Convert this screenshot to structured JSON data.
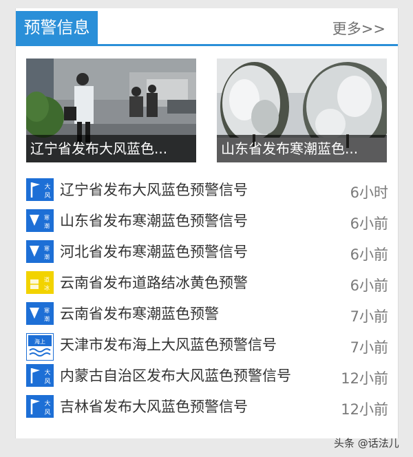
{
  "header": {
    "title": "预警信息",
    "more": "更多>>"
  },
  "featured": [
    {
      "caption": "辽宁省发布大风蓝色...",
      "image": "person-in-windy-street"
    },
    {
      "caption": "山东省发布寒潮蓝色...",
      "image": "snow-covered-trees"
    }
  ],
  "news": [
    {
      "icon": "gale-blue-signal-icon",
      "title": "辽宁省发布大风蓝色预警信号",
      "time": "6小时"
    },
    {
      "icon": "cold-wave-blue-signal-icon",
      "title": "山东省发布寒潮蓝色预警信号",
      "time": "6小前"
    },
    {
      "icon": "cold-wave-blue-signal-icon",
      "title": "河北省发布寒潮蓝色预警信号",
      "time": "6小前"
    },
    {
      "icon": "road-icing-yellow-signal-icon",
      "title": "云南省发布道路结冰黄色预警",
      "time": "6小前"
    },
    {
      "icon": "cold-wave-blue-signal-icon",
      "title": "云南省发布寒潮蓝色预警",
      "time": "7小前"
    },
    {
      "icon": "sea-gale-blue-signal-icon",
      "title": "天津市发布海上大风蓝色预警信号",
      "time": "7小前"
    },
    {
      "icon": "gale-blue-signal-icon",
      "title": "内蒙古自治区发布大风蓝色预警信号",
      "time": "12小前"
    },
    {
      "icon": "gale-blue-signal-icon",
      "title": "吉林省发布大风蓝色预警信号",
      "time": "12小前"
    }
  ],
  "watermark": "头条 @话法儿",
  "colors": {
    "accent": "#2a8fd8",
    "signal_blue": "#1d6fd6",
    "signal_yellow": "#f2d300"
  }
}
